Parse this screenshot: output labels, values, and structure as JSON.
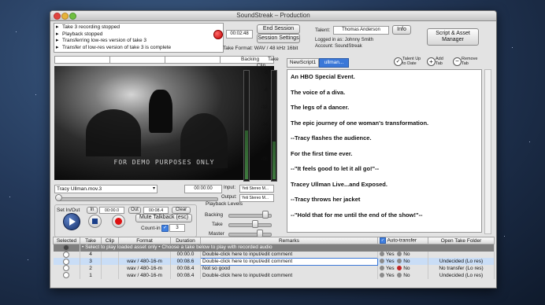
{
  "window": {
    "title": "SoundStreak – Production"
  },
  "log": [
    "Take 3 recording stopped",
    "Playback stopped",
    "Transferring low-res version of take 3",
    "Transfer of low-res version of take 3 is complete"
  ],
  "record": {
    "timecode": "00:02:48",
    "take_format": "Take Format: WAV / 48 kHz 16bit",
    "end_session": "End Session",
    "session_settings": "Session Settings"
  },
  "talent": {
    "label": "Talent:",
    "name": "Thomas Anderson",
    "info_button": "Info",
    "logged_in": "Logged in as: Johnny Smith",
    "account": "Account: SoundStreak"
  },
  "script_manager_button": "Script & Asset Manager",
  "meters": {
    "backing_label": "Backing",
    "take_label": "Take",
    "clip_label": "Clip",
    "scale": [
      "-3",
      "-6",
      "-12",
      "-24",
      "-48",
      "-96"
    ]
  },
  "video": {
    "watermark": "FOR DEMO PURPOSES ONLY"
  },
  "media": {
    "selected_file": "Tracy Ullman.mov.3",
    "time": "00:00:00",
    "input_label": "Input:",
    "input_value": "Yeti Stereo M...",
    "output_label": "Output:",
    "output_value": "Yeti Stereo M..."
  },
  "in_out": {
    "label": "Set In/Out",
    "in_button": "In",
    "in_value": "00:00.0",
    "out_button": "Out",
    "out_value": "00:08.4",
    "clear_button": "Clear"
  },
  "transport": {
    "mute_talkback": "Mute Talkback (esc)",
    "count_in_label": "Count-in",
    "count_in_value": "3"
  },
  "playback_levels": {
    "title": "Playback Levels",
    "backing": "Backing",
    "take": "Take",
    "master": "Master",
    "backing_level": 0.8,
    "take_level": 0.55,
    "master_level": 0.7
  },
  "script_tabs": {
    "tab1": "NewScript1",
    "tab2": "ullman...",
    "talent_up_to_date": "Talent Up to Date",
    "add_tab": "Add Tab",
    "remove_tab": "Remove Tab"
  },
  "script_lines": [
    "An HBO Special Event.",
    "The voice of a diva.",
    "The legs of a dancer.",
    "The epic journey of one woman's transformation.",
    "--Tracy flashes the audience.",
    "For the first time ever.",
    "--\"It feels good to let it all go!\"--",
    "Tracey Ullman Live...and Exposed.",
    "--Tracy throws her jacket",
    "--\"Hold that for me until the end of the show!\"--"
  ],
  "takes_table": {
    "headers": [
      "Selected",
      "Take",
      "Clip",
      "Format",
      "Duration",
      "Remarks"
    ],
    "auto_transfer_label": "Auto-transfer",
    "open_take_folder": "Open Take Folder",
    "hint": "• Select to play loaded asset only • Choose a take below to play with recorded audio",
    "rows": [
      {
        "take": "4",
        "clip": "",
        "format": "",
        "duration": "00:00.0",
        "remarks": "Double-click here to input/edit comment",
        "yes": "Yes",
        "no": "No",
        "status": "",
        "yes_color": "#8a8a8a",
        "no_color": "#8a8a8a"
      },
      {
        "take": "3",
        "clip": "",
        "format": "wav / 480-16-m",
        "duration": "00:08.6",
        "remarks": "Double-click here to input/edit comment",
        "yes": "Yes",
        "no": "No",
        "status": "Undecided (Lo res)",
        "yes_color": "#8a8a8a",
        "no_color": "#8a8a8a"
      },
      {
        "take": "2",
        "clip": "",
        "format": "wav / 480-16-m",
        "duration": "00:08.4",
        "remarks": "Not so good",
        "yes": "Yes",
        "no": "No",
        "status": "No transfer (Lo res)",
        "yes_color": "#8a8a8a",
        "no_color": "#c0262a"
      },
      {
        "take": "1",
        "clip": "",
        "format": "wav / 480-16-m",
        "duration": "00:08.4",
        "remarks": "Double-click here to input/edit comment",
        "yes": "Yes",
        "no": "No",
        "status": "Undecided (Lo res)",
        "yes_color": "#8a8a8a",
        "no_color": "#8a8a8a"
      }
    ]
  }
}
